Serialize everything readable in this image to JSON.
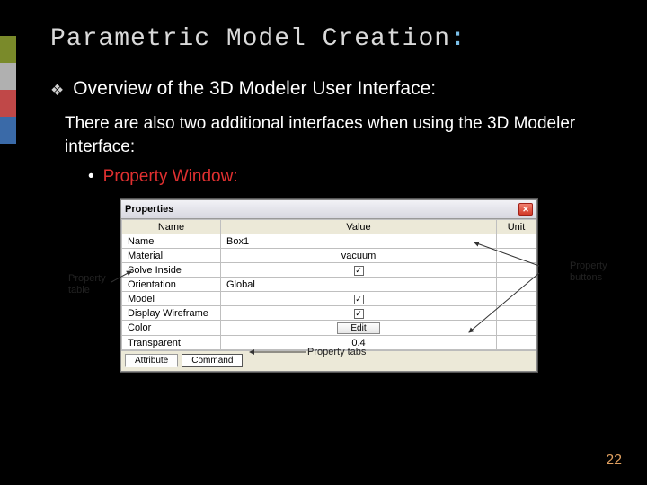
{
  "accent_colors": [
    "#7a8a2a",
    "#b0b0b0",
    "#c04848",
    "#3a6aa8"
  ],
  "title_main": "Parametric Model Creation",
  "title_colon": ":",
  "bullet1": "Overview of the 3D Modeler User Interface:",
  "para1": "There are also two additional interfaces when using the 3D Modeler interface:",
  "subbullet1": "Property Window:",
  "properties": {
    "window_title": "Properties",
    "headers": {
      "name": "Name",
      "value": "Value",
      "unit": "Unit"
    },
    "rows": [
      {
        "name": "Name",
        "value": "Box1",
        "type": "text"
      },
      {
        "name": "Material",
        "value": "vacuum",
        "type": "button"
      },
      {
        "name": "Solve Inside",
        "checked": true,
        "type": "check"
      },
      {
        "name": "Orientation",
        "value": "Global",
        "type": "text"
      },
      {
        "name": "Model",
        "checked": true,
        "type": "check"
      },
      {
        "name": "Display Wireframe",
        "checked": true,
        "type": "check"
      },
      {
        "name": "Color",
        "value": "Edit",
        "type": "edit"
      },
      {
        "name": "Transparent",
        "value": "0.4",
        "type": "button"
      }
    ],
    "tabs": {
      "active": "Attribute",
      "inactive": "Command"
    }
  },
  "callouts": {
    "left": "Property table",
    "right": "Property buttons",
    "bottom": "Property tabs"
  },
  "page_number": "22"
}
